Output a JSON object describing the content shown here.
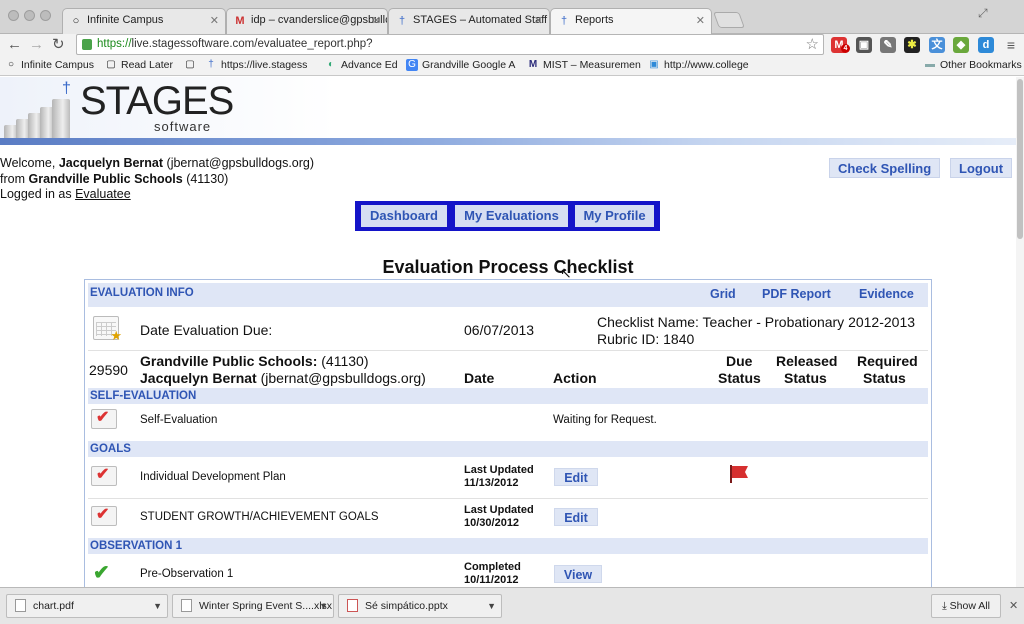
{
  "browser": {
    "tabs": [
      {
        "title": "Infinite Campus",
        "icon": "circle-icon"
      },
      {
        "title": "idp – cvanderslice@gpsbullc",
        "icon": "gmail-icon"
      },
      {
        "title": "STAGES – Automated Staff E",
        "icon": "stages-icon"
      },
      {
        "title": "Reports",
        "icon": "stages-icon"
      }
    ],
    "url_prefix": "https://",
    "url_rest": "live.stagessoftware.com/evaluatee_report.php?",
    "gmail_badge": "4",
    "bookmarks": [
      {
        "label": "Infinite Campus"
      },
      {
        "label": "Read Later"
      },
      {
        "label": ""
      },
      {
        "label": "https://live.stagess"
      },
      {
        "label": "Advance Ed"
      },
      {
        "label": "Grandville Google A"
      },
      {
        "label": "MIST – Measuremen"
      },
      {
        "label": "http://www.college"
      }
    ],
    "other_bookmarks": "Other Bookmarks"
  },
  "site": {
    "logo": "STAGES",
    "logo_sub": "software",
    "welcome": {
      "prefix": "Welcome, ",
      "name": "Jacquelyn Bernat",
      "email": "(jbernat@gpsbulldogs.org)",
      "from_prefix": "from ",
      "district": "Grandville Public Schools",
      "district_id": "(41130)",
      "logged_prefix": "Logged in as ",
      "role": "Evaluatee"
    },
    "top_buttons": {
      "spelling": "Check Spelling",
      "logout": "Logout"
    },
    "nav": {
      "dashboard": "Dashboard",
      "evaluations": "My Evaluations",
      "profile": "My Profile"
    }
  },
  "report": {
    "title": "Evaluation Process Checklist",
    "info_label": "EVALUATION INFO",
    "links": {
      "grid": "Grid",
      "pdf": "PDF Report",
      "evidence": "Evidence"
    },
    "date_due_label": "Date Evaluation Due:",
    "date_due": "06/07/2013",
    "checklist_name": "Checklist Name: Teacher - Probationary 2012-2013",
    "rubric_id": "Rubric ID: 1840",
    "eval_id": "29590",
    "district": "Grandville Public Schools:",
    "district_id": "(41130)",
    "evaluatee": "Jacquelyn Bernat",
    "evaluatee_email": "(jbernat@gpsbulldogs.org)",
    "columns": {
      "date": "Date",
      "action": "Action",
      "due1": "Due",
      "due2": "Status",
      "released1": "Released",
      "released2": "Status",
      "required1": "Required",
      "required2": "Status"
    },
    "sections": {
      "self": "SELF-EVALUATION",
      "goals": "GOALS",
      "obs1": "OBSERVATION 1"
    },
    "rows": {
      "self_eval": {
        "name": "Self-Evaluation",
        "action_text": "Waiting for Request."
      },
      "idp": {
        "name": "Individual Development Plan",
        "date1": "Last Updated",
        "date2": "11/13/2012",
        "action": "Edit"
      },
      "growth": {
        "name": "STUDENT GROWTH/ACHIEVEMENT GOALS",
        "date1": "Last Updated",
        "date2": "10/30/2012",
        "action": "Edit"
      },
      "preobs": {
        "name": "Pre-Observation 1",
        "date1": "Completed",
        "date2": "10/11/2012",
        "action": "View"
      }
    },
    "colors": {
      "accent": "#2f55b4",
      "section_bg": "#dfe6f6",
      "nav_border": "#1414c8"
    }
  },
  "downloads": {
    "items": [
      {
        "name": "chart.pdf"
      },
      {
        "name": "Winter Spring Event S....xlsx"
      },
      {
        "name": "Sé simpático.pptx"
      }
    ],
    "show_all": "Show All"
  }
}
